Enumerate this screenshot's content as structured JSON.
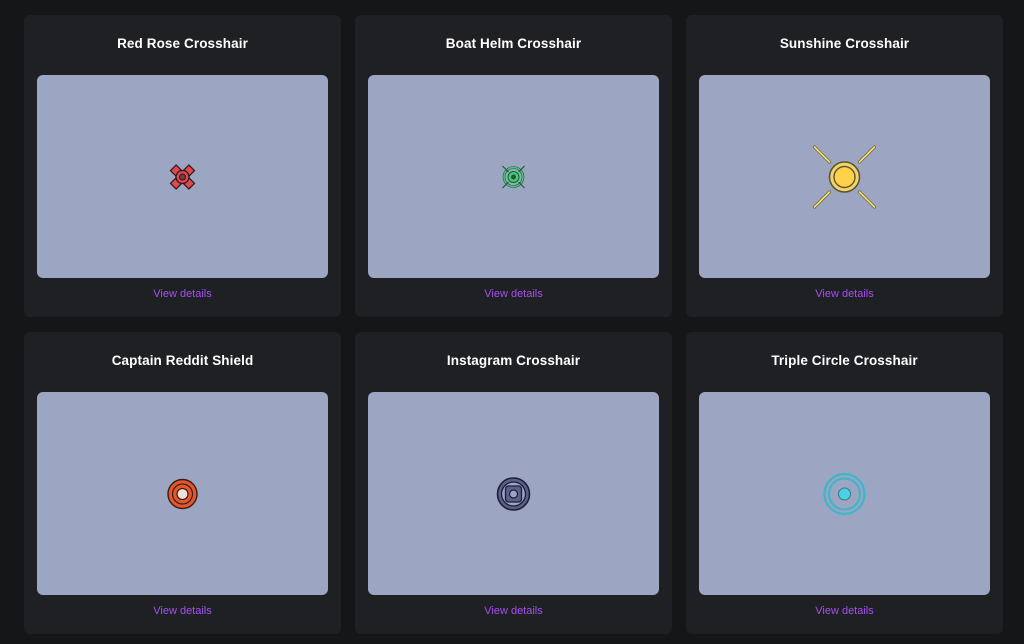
{
  "cards": [
    {
      "title": "Red Rose Crosshair",
      "link": "View details",
      "icon": "red-rose-crosshair-icon",
      "color": "#e2474e"
    },
    {
      "title": "Boat Helm Crosshair",
      "link": "View details",
      "icon": "boat-helm-crosshair-icon",
      "color": "#3ecf6e"
    },
    {
      "title": "Sunshine Crosshair",
      "link": "View details",
      "icon": "sunshine-crosshair-icon",
      "color": "#ffd566"
    },
    {
      "title": "Captain Reddit Shield",
      "link": "View details",
      "icon": "captain-reddit-shield-icon",
      "color": "#e4572e"
    },
    {
      "title": "Instagram Crosshair",
      "link": "View details",
      "icon": "instagram-crosshair-icon",
      "color": "#5a5f8c"
    },
    {
      "title": "Triple Circle Crosshair",
      "link": "View details",
      "icon": "triple-circle-crosshair-icon",
      "color": "#3fb6c8"
    }
  ],
  "colors": {
    "background": "#151618",
    "card": "#1f2023",
    "preview": "#9ca5c2",
    "link": "#a54ff0"
  }
}
